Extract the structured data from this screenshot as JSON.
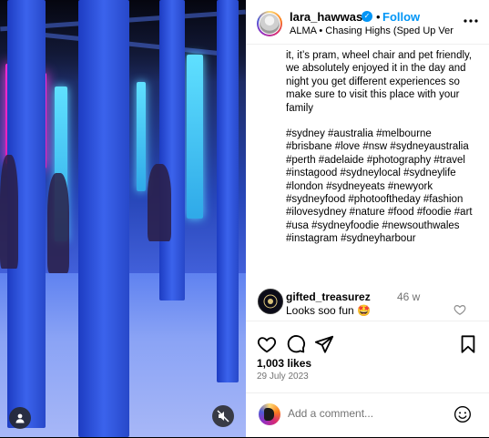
{
  "post": {
    "username": "lara_hawwash",
    "separator": "•",
    "follow_label": "Follow",
    "audio_label": "ALMA • Chasing Highs (Sped Up Vers...",
    "caption": {
      "body": "it, it’s pram, wheel chair and pet friendly, we absolutely enjoyed it in the day and night you get different experiences so make sure to visit this place with your family",
      "hashtags": "#sydney #australia #melbourne #brisbane #love #nsw #sydneyaustralia #perth #adelaide #photography #travel #instagood #sydneylocal #sydneylife #london #sydneyeats #newyork #sydneyfood #photooftheday #fashion #ilovesydney #nature #food #foodie #art #usa #sydneyfoodie #newsouthwales #instagram #sydneyharbour"
    },
    "comment": {
      "username": "gifted_treasurez",
      "time": "46 w",
      "text": "Looks soo fun 🤩"
    },
    "likes": "1,003 likes",
    "date": "29 July 2023",
    "composer_placeholder": "Add a comment..."
  },
  "icons": {
    "verified": "verified-badge-icon",
    "more": "more-options-icon",
    "like": "heart-icon",
    "comment": "comment-icon",
    "share": "share-icon",
    "save": "bookmark-icon",
    "emoji": "emoji-icon",
    "tagged_users": "user-icon",
    "mute": "muted-speaker-icon"
  },
  "colors": {
    "accent": "#0095f6",
    "muted_text": "#737373",
    "divider": "#efefef"
  }
}
